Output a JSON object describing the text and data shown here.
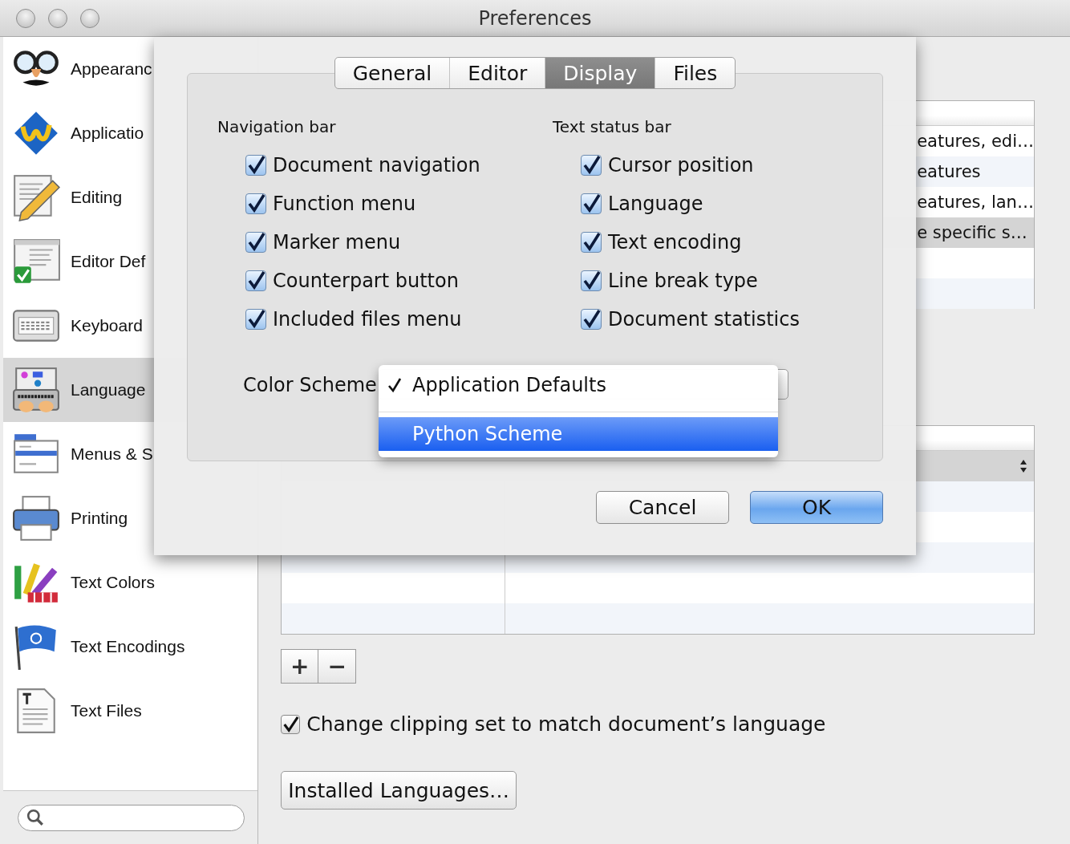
{
  "window": {
    "title": "Preferences"
  },
  "sidebar": {
    "items": [
      {
        "label": "Appearanc",
        "selected": false
      },
      {
        "label": "Applicatio",
        "selected": false
      },
      {
        "label": "Editing",
        "selected": false
      },
      {
        "label": "Editor Def",
        "selected": false
      },
      {
        "label": "Keyboard",
        "selected": false
      },
      {
        "label": "Language",
        "selected": true
      },
      {
        "label": "Menus & S",
        "selected": false
      },
      {
        "label": "Printing",
        "selected": false
      },
      {
        "label": "Text Colors",
        "selected": false
      },
      {
        "label": "Text Encodings",
        "selected": false
      },
      {
        "label": "Text Files",
        "selected": false
      }
    ]
  },
  "languages_table": {
    "rows": [
      {
        "column_2": "eatures, edi…",
        "selected": false
      },
      {
        "column_2": "eatures",
        "selected": false
      },
      {
        "column_2": "eatures, lan…",
        "selected": false
      },
      {
        "column_2": "e specific s…",
        "selected": true
      },
      {
        "selected": false
      },
      {
        "selected": false
      }
    ]
  },
  "suffix_table": {
    "rows": [
      {
        "selected": true
      },
      {
        "selected": false
      },
      {
        "selected": false
      },
      {
        "selected": false
      },
      {
        "selected": false
      },
      {
        "selected": false
      }
    ]
  },
  "add_button": "+",
  "remove_button": "−",
  "clipping_checkbox": {
    "label": "Change clipping set to match document’s language",
    "checked": true
  },
  "installed_languages_button": "Installed Languages…",
  "sheet": {
    "tabs": [
      {
        "label": "General",
        "selected": false
      },
      {
        "label": "Editor",
        "selected": false
      },
      {
        "label": "Display",
        "selected": true
      },
      {
        "label": "Files",
        "selected": false
      }
    ],
    "groups": [
      {
        "title": "Navigation bar",
        "options": [
          {
            "label": "Document navigation",
            "checked": true
          },
          {
            "label": "Function menu",
            "checked": true
          },
          {
            "label": "Marker menu",
            "checked": true
          },
          {
            "label": "Counterpart button",
            "checked": true
          },
          {
            "label": "Included files menu",
            "checked": true
          }
        ]
      },
      {
        "title": "Text status bar",
        "options": [
          {
            "label": "Cursor position",
            "checked": true
          },
          {
            "label": "Language",
            "checked": true
          },
          {
            "label": "Text encoding",
            "checked": true
          },
          {
            "label": "Line break type",
            "checked": true
          },
          {
            "label": "Document statistics",
            "checked": true
          }
        ]
      }
    ],
    "color_scheme": {
      "label": "Color Scheme",
      "menu": [
        {
          "label": "Application Defaults",
          "checked": true,
          "selected": false
        },
        {
          "label": "Python Scheme",
          "checked": false,
          "selected": true
        }
      ]
    },
    "buttons": [
      {
        "label": "Cancel",
        "default": false
      },
      {
        "label": "OK",
        "default": true
      }
    ]
  }
}
